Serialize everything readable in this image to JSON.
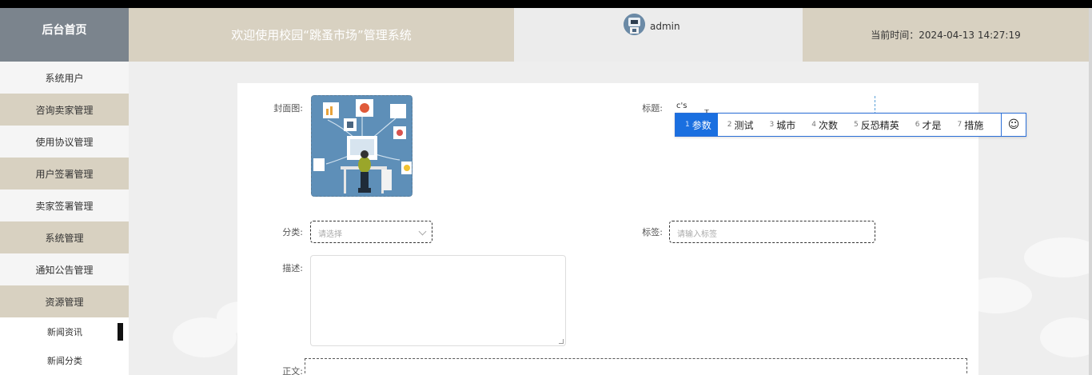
{
  "header": {
    "brand": "后台首页",
    "system_title": "欢迎使用校园“跳蚤市场”管理系统",
    "username": "admin",
    "time_label": "当前时间：",
    "time_value": "2024-04-13 14:27:19"
  },
  "sidebar": {
    "items": [
      {
        "label": "系统用户"
      },
      {
        "label": "咨询卖家管理"
      },
      {
        "label": "使用协议管理"
      },
      {
        "label": "用户签署管理"
      },
      {
        "label": "卖家签署管理"
      },
      {
        "label": "系统管理"
      },
      {
        "label": "通知公告管理"
      },
      {
        "label": "资源管理"
      }
    ],
    "subitems": [
      {
        "label": "新闻资讯"
      },
      {
        "label": "新闻分类"
      }
    ]
  },
  "form": {
    "cover_label": "封面图:",
    "title_label": "标题:",
    "title_value": "c's",
    "category_label": "分类:",
    "category_placeholder": "请选择",
    "tag_label": "标签:",
    "tag_placeholder": "请输入标签",
    "desc_label": "描述:",
    "content_label": "正文:"
  },
  "ime": {
    "candidates": [
      {
        "num": "1",
        "text": "参数"
      },
      {
        "num": "2",
        "text": "测试"
      },
      {
        "num": "3",
        "text": "城市"
      },
      {
        "num": "4",
        "text": "次数"
      },
      {
        "num": "5",
        "text": "反恐精英"
      },
      {
        "num": "6",
        "text": "才是"
      },
      {
        "num": "7",
        "text": "措施"
      }
    ],
    "emoji_icon": "smiley-icon"
  },
  "colors": {
    "brand_bg": "#7b848d",
    "header_beige": "#d8d1c1",
    "ime_accent": "#1a6fe0"
  }
}
